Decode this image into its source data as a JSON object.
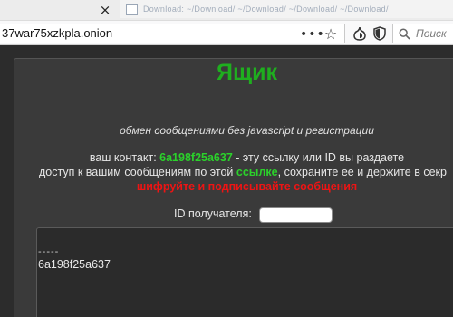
{
  "browser": {
    "tab_close_glyph": "×",
    "tab_ghost_text": "Download: ~/Download/ ~/Download/ ~/Download/ ~/Download/",
    "url": "37war75xzkpla.onion",
    "url_menu_glyph": "•••",
    "url_star_glyph": "☆",
    "search_placeholder": "Поиск",
    "icons": [
      "close-icon",
      "page-actions-menu-icon",
      "bookmark-star-icon",
      "onion-icon",
      "shield-icon",
      "search-icon"
    ]
  },
  "page": {
    "title": "Ящик",
    "subtitle": "обмен сообщениями без javascript и регистрации",
    "contact_prefix": "ваш контакт: ",
    "contact_id": "6a198f25a637",
    "contact_suffix": " - эту ссылку или ID вы раздаете",
    "access_prefix": "доступ к вашим сообщениям по этой ",
    "access_link": "ссылке",
    "access_suffix": ", сохраните ее и держите в секр",
    "warning": "шифруйте и подписывайте сообщения",
    "recipient_label": "ID получателя:",
    "recipient_value": "",
    "message_separator": "-----",
    "message_id": "6a198f25a637"
  },
  "colors": {
    "title_green": "#1fae1f",
    "accent_green": "#2bd12b",
    "warning_red": "#ee1414",
    "panel_bg": "#3a3a3a",
    "page_bg": "#2c2c2c"
  }
}
